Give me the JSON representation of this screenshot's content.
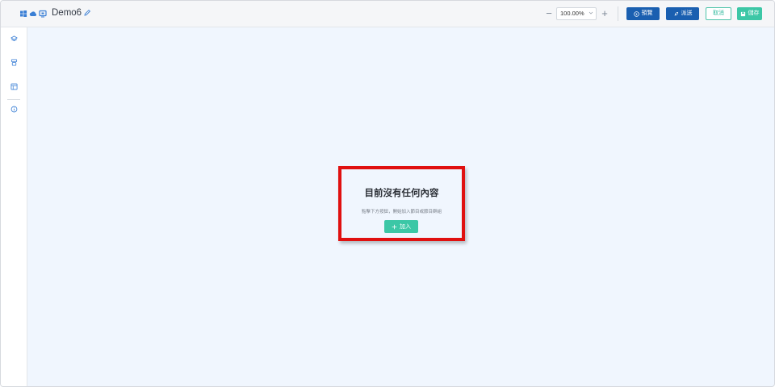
{
  "header": {
    "title": "Demo6",
    "zoom": {
      "minus_label": "−",
      "plus_label": "+",
      "value": "100.00%"
    },
    "buttons": {
      "preview": "預覽",
      "publish": "派送",
      "cancel": "取消",
      "save": "儲存"
    }
  },
  "sidebar": {
    "icons": [
      "layers-icon",
      "user-group-icon",
      "panel-icon",
      "info-icon"
    ]
  },
  "empty_state": {
    "title": "目前沒有任何內容",
    "description": "點擊下方按鈕，開始加入節目或節目群組",
    "add_button": "加入"
  },
  "colors": {
    "primary_blue": "#1a5fb0",
    "accent_green": "#3cc7a6",
    "canvas_bg": "#f0f6fe",
    "highlight_red": "#e01010",
    "icon_blue": "#3a7fd5"
  }
}
